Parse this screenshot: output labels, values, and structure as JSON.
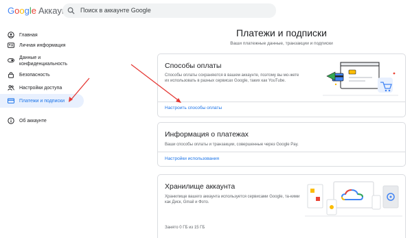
{
  "header": {
    "logo_brand": "Google",
    "logo_product": "Аккаунт",
    "search_placeholder": "Поиск в аккаунте Google"
  },
  "sidebar": {
    "items": [
      {
        "label": "Главная",
        "icon": "home-icon"
      },
      {
        "label": "Личная информация",
        "icon": "id-card-icon"
      },
      {
        "label": "Данные и конфиденциальность",
        "icon": "privacy-toggle-icon"
      },
      {
        "label": "Безопасность",
        "icon": "lock-icon"
      },
      {
        "label": "Настройки доступа",
        "icon": "people-icon"
      },
      {
        "label": "Платежи и подписки",
        "icon": "credit-card-icon",
        "active": true
      },
      {
        "label": "Об аккаунте",
        "icon": "info-icon"
      }
    ]
  },
  "main": {
    "title": "Платежи и подписки",
    "subtitle": "Ваши платежные данные, транзакции и подписки",
    "cards": [
      {
        "title": "Способы оплаты",
        "description": "Способы оплаты сохраняются в вашем аккаунте, поэтому вы мо-жете их использовать в разных сервисах Google, таких как YouTube.",
        "link": "Настроить способы оплаты"
      },
      {
        "title": "Информация о платежах",
        "description": "Ваши способы оплаты и транзакции, совершенные через Google Pay.",
        "link": "Настройки использования"
      },
      {
        "title": "Хранилище аккаунта",
        "description": "Хранилище вашего аккаунта используется сервисами Google, та-кими как Диск, Gmail и Фото.",
        "footer": "Занято 0 ГБ из 15 ГБ"
      }
    ]
  },
  "colors": {
    "accent": "#1a73e8",
    "active_bg": "#e8f0fe",
    "annotation_arrow": "#e53935"
  }
}
